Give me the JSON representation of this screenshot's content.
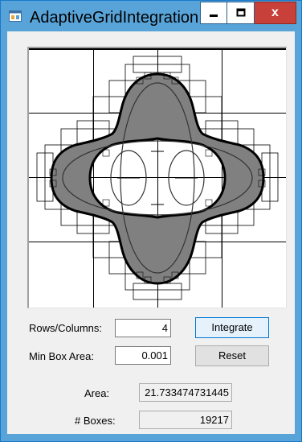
{
  "window": {
    "title": "AdaptiveGridIntegration",
    "close_glyph": "x"
  },
  "form": {
    "rows_label": "Rows/Columns:",
    "rows_value": "4",
    "min_area_label": "Min Box Area:",
    "min_area_value": "0.001",
    "integrate_label": "Integrate",
    "reset_label": "Reset",
    "area_label": "Area:",
    "area_value": "21.733474731445",
    "boxes_label": "# Boxes:",
    "boxes_value": "19217"
  },
  "colors": {
    "titlebar": "#58a4d9",
    "close_button": "#c7413a",
    "client_background": "#f0f0f0",
    "region_fill": "#808080"
  },
  "icons": [
    "app-icon",
    "minimize-icon",
    "maximize-icon",
    "close-icon"
  ]
}
